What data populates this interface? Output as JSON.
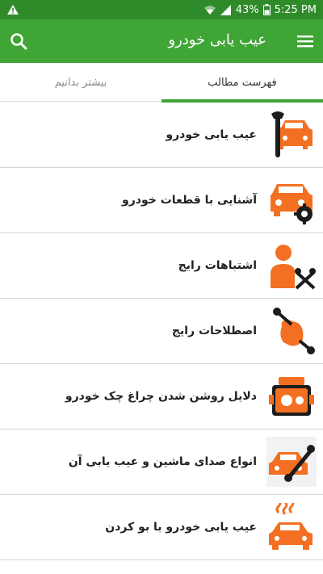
{
  "status": {
    "battery": "43%",
    "time": "5:25 PM"
  },
  "app": {
    "title": "عیب یابی خودرو",
    "menu_icon": "menu-icon",
    "search_icon": "search-icon"
  },
  "tabs": [
    {
      "label": "فهرست مطالب",
      "active": true
    },
    {
      "label": "بیشتر بدانیم",
      "active": false
    }
  ],
  "items": [
    {
      "label": "عیب یابی خودرو",
      "icon": "car-wrench-icon"
    },
    {
      "label": "آشنایی با قطعات خودرو",
      "icon": "car-gear-icon"
    },
    {
      "label": "اشتباهات رایج",
      "icon": "mechanic-tools-icon"
    },
    {
      "label": "اصطلاحات رایج",
      "icon": "hand-wrench-icon"
    },
    {
      "label": "دلایل روشن شدن چراغ چک خودرو",
      "icon": "engine-icon"
    },
    {
      "label": "انواع صدای ماشین و عیب یابی آن",
      "icon": "car-repair-icon"
    },
    {
      "label": "عیب یابی خودرو با بو کردن",
      "icon": "car-smoke-icon"
    }
  ],
  "colors": {
    "primary": "#3fa535",
    "status": "#2f8a2a",
    "accent_orange": "#f36f21",
    "dark": "#1c1c1c"
  }
}
